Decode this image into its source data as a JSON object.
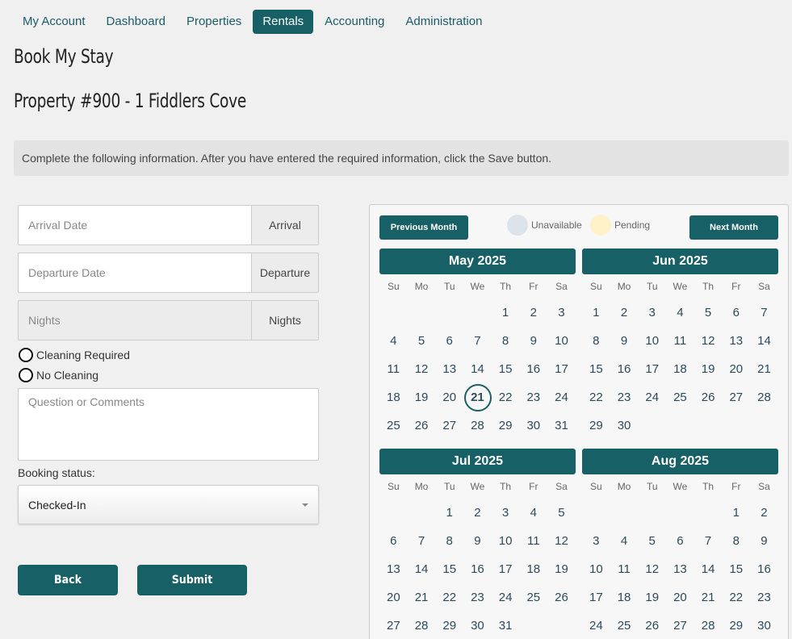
{
  "nav": {
    "items": [
      "My Account",
      "Dashboard",
      "Properties",
      "Rentals",
      "Accounting",
      "Administration"
    ],
    "active_index": 3
  },
  "titles": {
    "page": "Book My Stay",
    "property": "Property #900 - 1 Fiddlers Cove"
  },
  "info_text": "Complete the following information. After you have entered the required information, click the Save button.",
  "form": {
    "arrival": {
      "placeholder": "Arrival Date",
      "addon": "Arrival"
    },
    "departure": {
      "placeholder": "Departure Date",
      "addon": "Departure"
    },
    "nights": {
      "placeholder": "Nights",
      "addon": "Nights"
    },
    "cleaning_required": "Cleaning Required",
    "no_cleaning": "No Cleaning",
    "comments_placeholder": "Question or Comments",
    "booking_status_label": "Booking status:",
    "booking_status_value": "Checked-In",
    "back_label": "Back",
    "submit_label": "Submit"
  },
  "calendar": {
    "prev_label": "Previous Month",
    "next_label": "Next Month",
    "legend_unavailable": "Unavailable",
    "legend_pending": "Pending",
    "colors": {
      "accent": "#176066",
      "unavailable": "#dde3ea",
      "pending": "#fff2c8"
    },
    "dow": [
      "Su",
      "Mo",
      "Tu",
      "We",
      "Th",
      "Fr",
      "Sa"
    ],
    "months": [
      {
        "title": "May 2025",
        "weeks": [
          [
            "",
            "",
            "",
            "",
            "1",
            "2",
            "3"
          ],
          [
            "4",
            "5",
            "6",
            "7",
            "8",
            "9",
            "10"
          ],
          [
            "11",
            "12",
            "13",
            "14",
            "15",
            "16",
            "17"
          ],
          [
            "18",
            "19",
            "20",
            "21",
            "22",
            "23",
            "24"
          ],
          [
            "25",
            "26",
            "27",
            "28",
            "29",
            "30",
            "31"
          ]
        ],
        "today": "21"
      },
      {
        "title": "Jun 2025",
        "weeks": [
          [
            "1",
            "2",
            "3",
            "4",
            "5",
            "6",
            "7"
          ],
          [
            "8",
            "9",
            "10",
            "11",
            "12",
            "13",
            "14"
          ],
          [
            "15",
            "16",
            "17",
            "18",
            "19",
            "20",
            "21"
          ],
          [
            "22",
            "23",
            "24",
            "25",
            "26",
            "27",
            "28"
          ],
          [
            "29",
            "30",
            "",
            "",
            "",
            "",
            ""
          ]
        ]
      },
      {
        "title": "Jul 2025",
        "weeks": [
          [
            "",
            "",
            "1",
            "2",
            "3",
            "4",
            "5"
          ],
          [
            "6",
            "7",
            "8",
            "9",
            "10",
            "11",
            "12"
          ],
          [
            "13",
            "14",
            "15",
            "16",
            "17",
            "18",
            "19"
          ],
          [
            "20",
            "21",
            "22",
            "23",
            "24",
            "25",
            "26"
          ],
          [
            "27",
            "28",
            "29",
            "30",
            "31",
            "",
            ""
          ]
        ]
      },
      {
        "title": "Aug 2025",
        "weeks": [
          [
            "",
            "",
            "",
            "",
            "",
            "1",
            "2"
          ],
          [
            "3",
            "4",
            "5",
            "6",
            "7",
            "8",
            "9"
          ],
          [
            "10",
            "11",
            "12",
            "13",
            "14",
            "15",
            "16"
          ],
          [
            "17",
            "18",
            "19",
            "20",
            "21",
            "22",
            "23"
          ],
          [
            "24",
            "25",
            "26",
            "27",
            "28",
            "29",
            "30"
          ]
        ]
      }
    ]
  }
}
